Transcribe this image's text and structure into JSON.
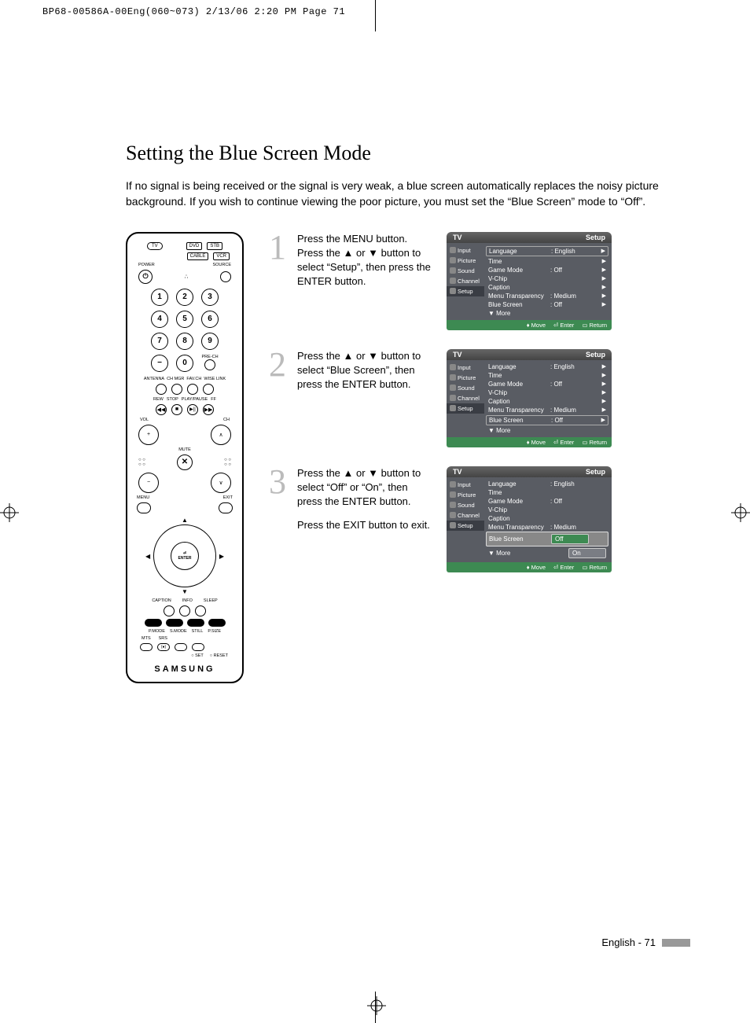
{
  "crop_header": "BP68-00586A-00Eng(060~073)  2/13/06  2:20 PM  Page 71",
  "title": "Setting the Blue Screen Mode",
  "intro": "If no signal is being received or the signal is very weak, a blue screen automatically replaces the noisy picture background. If you wish to continue viewing the poor picture, you must set the “Blue Screen” mode to “Off”.",
  "remote": {
    "top_buttons": [
      "TV",
      "DVD",
      "STB",
      "CABLE",
      "VCR"
    ],
    "power": "POWER",
    "source": "SOURCE",
    "numpad": [
      "1",
      "2",
      "3",
      "4",
      "5",
      "6",
      "7",
      "8",
      "9",
      "−",
      "0"
    ],
    "prech": "PRE-CH",
    "row_labels": [
      "ANTENNA",
      "CH MGR",
      "FAV.CH",
      "WISE LINK"
    ],
    "transport": [
      "REW",
      "STOP",
      "PLAY/PAUSE",
      "FF"
    ],
    "vol": "VOL",
    "ch": "CH",
    "mute": "MUTE",
    "menu": "MENU",
    "exit": "EXIT",
    "enter": "ENTER",
    "caption": "CAPTION",
    "info": "INFO",
    "sleep": "SLEEP",
    "modes": [
      "P.MODE",
      "S.MODE",
      "STILL",
      "P.SIZE"
    ],
    "bottom": [
      "MTS",
      "SRS"
    ],
    "setreset": [
      "SET",
      "RESET"
    ],
    "brand": "SAMSUNG"
  },
  "steps": [
    {
      "num": "1",
      "text": "Press the MENU button. Press the ▲ or ▼ button to select “Setup”, then press the ENTER button."
    },
    {
      "num": "2",
      "text": "Press the ▲ or ▼ button to select “Blue Screen”, then press the ENTER button."
    },
    {
      "num": "3",
      "text": "Press the ▲ or ▼ button to select “Off” or “On”, then press the ENTER button.",
      "text2": "Press the EXIT button to exit."
    }
  ],
  "osd_common": {
    "tv": "TV",
    "setup": "Setup",
    "side": [
      "Input",
      "Picture",
      "Sound",
      "Channel",
      "Setup"
    ],
    "rows": [
      {
        "k": "Language",
        "v": ": English"
      },
      {
        "k": "Time",
        "v": ""
      },
      {
        "k": "Game Mode",
        "v": ": Off"
      },
      {
        "k": "V-Chip",
        "v": ""
      },
      {
        "k": "Caption",
        "v": ""
      },
      {
        "k": "Menu Transparency",
        "v": ": Medium"
      },
      {
        "k": "Blue Screen",
        "v": ": Off"
      },
      {
        "k": "▼ More",
        "v": ""
      }
    ],
    "foot": [
      "Move",
      "Enter",
      "Return"
    ],
    "options": [
      "Off",
      "On"
    ]
  },
  "footer": "English - 71"
}
